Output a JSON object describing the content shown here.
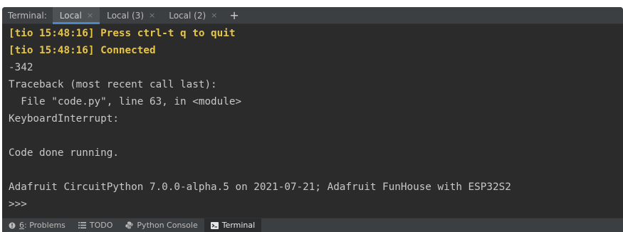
{
  "tabbar": {
    "title": "Terminal:",
    "tabs": [
      {
        "label": "Local",
        "close": "×"
      },
      {
        "label": "Local (3)",
        "close": "×"
      },
      {
        "label": "Local (2)",
        "close": "×"
      }
    ],
    "add": "+"
  },
  "console": {
    "lines": [
      "[tio 15:48:16] Press ctrl-t q to quit",
      "[tio 15:48:16] Connected",
      "-342",
      "Traceback (most recent call last):",
      "  File \"code.py\", line 63, in <module>",
      "KeyboardInterrupt:",
      "",
      "Code done running.",
      "",
      "Adafruit CircuitPython 7.0.0-alpha.5 on 2021-07-21; Adafruit FunHouse with ESP32S2",
      ">>>"
    ]
  },
  "statusbar": {
    "problems": {
      "mnemonic": "6",
      "label": ": Problems"
    },
    "todo": "TODO",
    "python_console": "Python Console",
    "terminal": "Terminal"
  },
  "colors": {
    "background": "#2b2b2b",
    "tio_text": "#e7c547",
    "text": "#c8c8c8",
    "active_tab_underline": "#4a88c7"
  }
}
